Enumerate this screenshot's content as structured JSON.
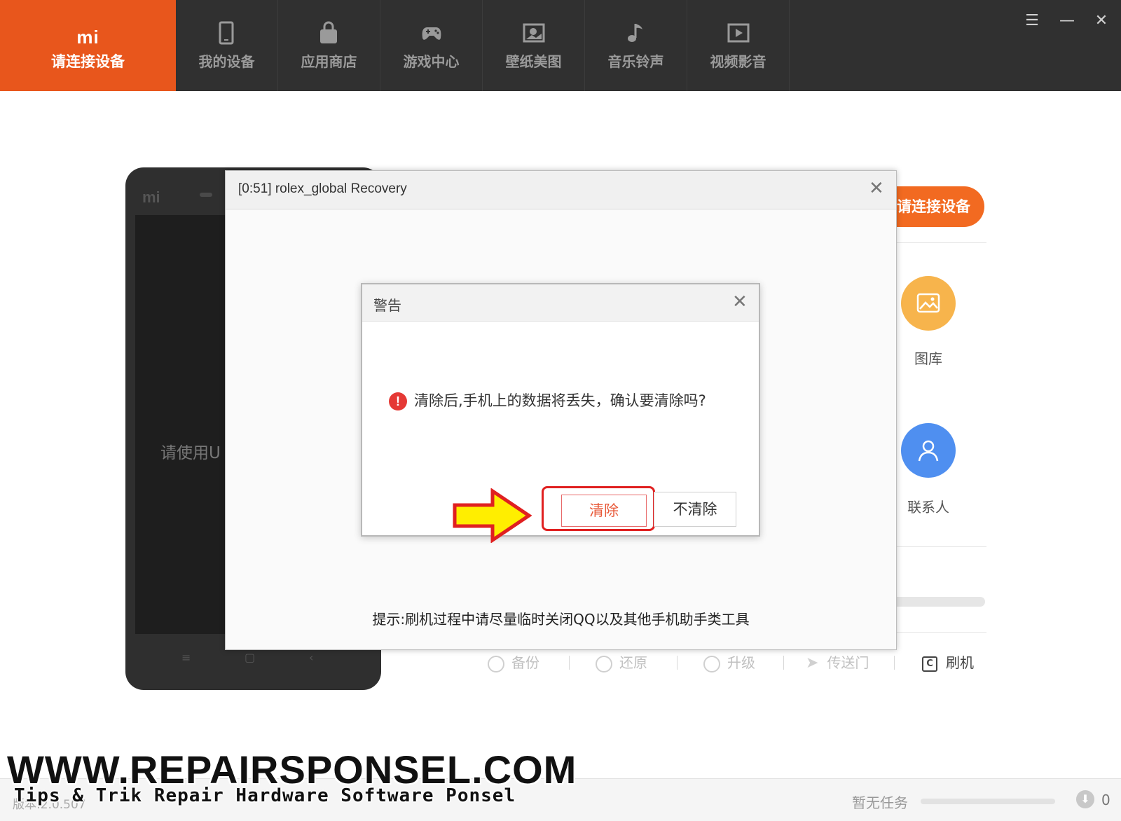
{
  "nav": {
    "logo": "mi",
    "connect_label": "请连接设备",
    "tabs": [
      {
        "label": "我的设备",
        "icon": "phone-icon"
      },
      {
        "label": "应用商店",
        "icon": "bag-icon"
      },
      {
        "label": "游戏中心",
        "icon": "gamepad-icon"
      },
      {
        "label": "壁纸美图",
        "icon": "picture-icon"
      },
      {
        "label": "音乐铃声",
        "icon": "music-note-icon"
      },
      {
        "label": "视频影音",
        "icon": "video-play-icon"
      }
    ],
    "window_controls": {
      "menu": "☰",
      "minimize": "—",
      "close": "✕"
    }
  },
  "phone": {
    "brand": "mi",
    "screen_message": "请使用U"
  },
  "right_panel": {
    "connect_button": "请连接设备",
    "gallery_label": "图库",
    "contacts_label": "联系人",
    "actions": [
      {
        "label": "备份",
        "icon": "backup-icon"
      },
      {
        "label": "还原",
        "icon": "restore-icon"
      },
      {
        "label": "升级",
        "icon": "upgrade-icon"
      },
      {
        "label": "传送门",
        "icon": "send-icon"
      }
    ],
    "flash_label": "刷机",
    "colors": {
      "gallery": "#f7b44c",
      "contacts": "#4f8ff0"
    }
  },
  "recovery_dialog": {
    "title": "[0:51] rolex_global Recovery",
    "hint": "提示:刷机过程中请尽量临时关闭QQ以及其他手机助手类工具"
  },
  "warning_dialog": {
    "title": "警告",
    "message": "清除后,手机上的数据将丢失，确认要清除吗?",
    "confirm_button": "清除",
    "cancel_button": "不清除"
  },
  "status_bar": {
    "version": "版本:2.0.507",
    "task_status": "暂无任务",
    "download_count": "0"
  },
  "watermark": {
    "site": "WWW.REPAIRSPONSEL.COM",
    "tagline": "Tips & Trik Repair Hardware Software Ponsel"
  },
  "colors": {
    "accent": "#e8561c",
    "topbar": "#303030",
    "warning_red": "#e02020",
    "arrow_yellow": "#ffee00"
  }
}
